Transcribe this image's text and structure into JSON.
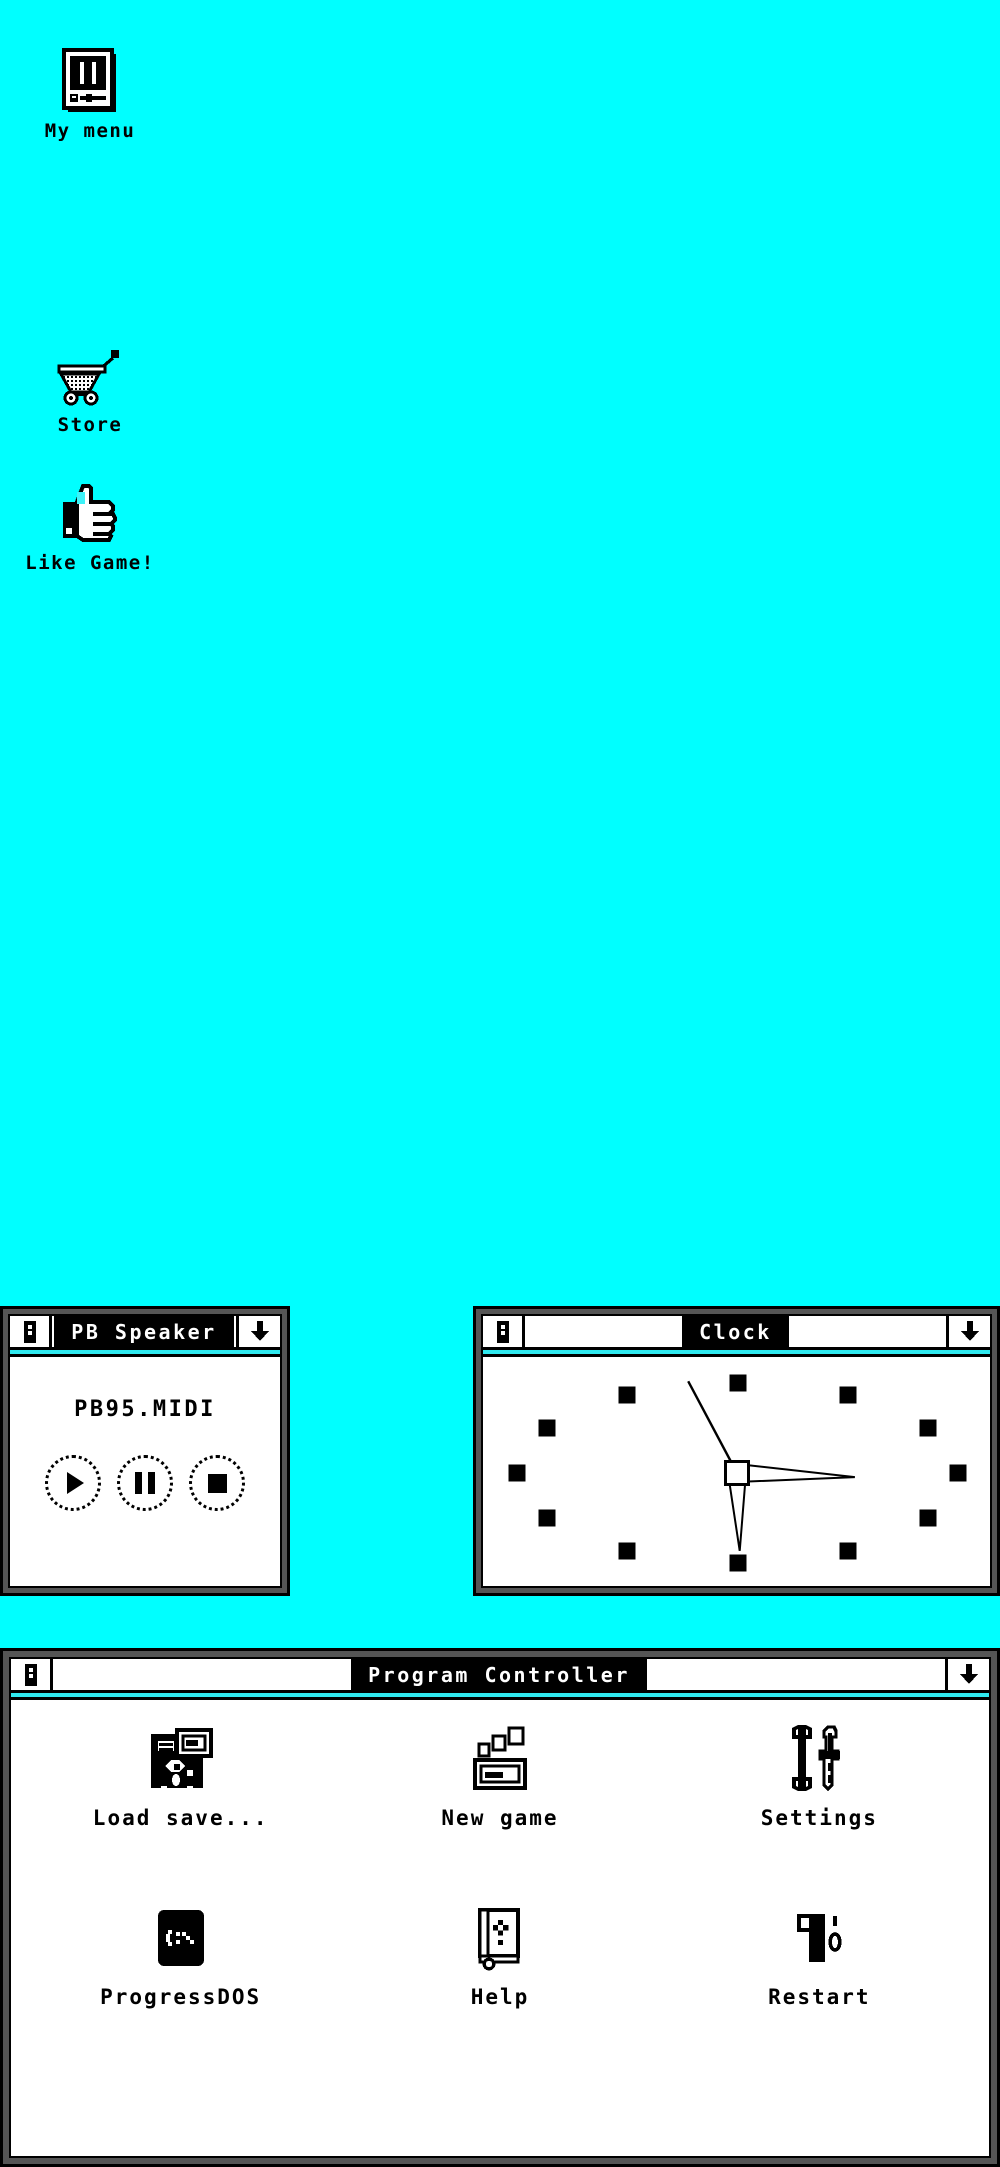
{
  "desktop": {
    "background_color": "#00ffff",
    "icons": [
      {
        "label": "My menu",
        "icon": "handheld-console-icon"
      },
      {
        "label": "Store",
        "icon": "shopping-cart-icon"
      },
      {
        "label": "Like Game!",
        "icon": "thumbs-up-icon"
      }
    ]
  },
  "windows": {
    "speaker": {
      "title": "PB Speaker",
      "sysmenu_icon": "system-menu-icon",
      "minimize_icon": "minimize-arrow-icon",
      "track": "PB95.MIDI",
      "controls": [
        {
          "name": "play",
          "label": "play-button",
          "glyph": "play-icon"
        },
        {
          "name": "pause",
          "label": "pause-button",
          "glyph": "pause-icon"
        },
        {
          "name": "stop",
          "label": "stop-button",
          "glyph": "stop-icon"
        }
      ]
    },
    "clock": {
      "title": "Clock",
      "sysmenu_icon": "system-menu-icon",
      "minimize_icon": "minimize-arrow-icon",
      "hour_angle": 88,
      "minute_angle": 2,
      "second_angle": -118,
      "tick_count": 12
    },
    "program_controller": {
      "title": "Program Controller",
      "sysmenu_icon": "system-menu-icon",
      "minimize_icon": "minimize-arrow-icon",
      "items": [
        {
          "label": "Load save...",
          "icon": "floppy-disk-icon"
        },
        {
          "label": "New game",
          "icon": "monitor-new-icon"
        },
        {
          "label": "Settings",
          "icon": "wrench-screwdriver-icon"
        },
        {
          "label": "ProgressDOS",
          "icon": "dos-prompt-icon"
        },
        {
          "label": "Help",
          "icon": "help-book-icon"
        },
        {
          "label": "Restart",
          "icon": "power-switch-icon"
        }
      ]
    }
  },
  "colors": {
    "desktop": "#00ffff",
    "accent": "#2fe9ef",
    "window_bg": "#ffffff",
    "border": "#000000",
    "frame": "#555555"
  }
}
